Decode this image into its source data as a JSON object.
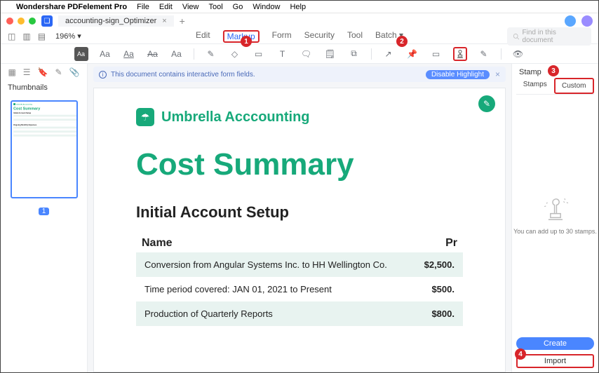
{
  "macmenu": {
    "app": "Wondershare PDFelement Pro",
    "items": [
      "File",
      "Edit",
      "View",
      "Tool",
      "Go",
      "Window",
      "Help"
    ]
  },
  "titlebar": {
    "tab_name": "accounting-sign_Optimizer",
    "close": "×",
    "plus": "+"
  },
  "secondbar": {
    "zoom": "196%  ▾",
    "modes": {
      "edit": "Edit",
      "markup": "Markup",
      "form": "Form",
      "security": "Security",
      "tool": "Tool",
      "batch": "Batch ▾"
    },
    "search_placeholder": "Find in this document"
  },
  "markuptools": {
    "text_bg": "Aa",
    "t1": "Aa",
    "t2": "Aa",
    "t3": "Aa",
    "t4": "Aa",
    "pencil": "✎",
    "eraser": "◇",
    "highlighter": "▭",
    "textbox": "T",
    "callout": "🗨",
    "note": "🗒",
    "link": "⧉",
    "arrow": "↗",
    "pin": "📌",
    "area": "▭",
    "stamp": "⌷",
    "sign": "✎",
    "eye": "👁"
  },
  "formbanner": {
    "text": "This document contains interactive form fields.",
    "disable": "Disable Highlight",
    "close": "×",
    "info": "i"
  },
  "left": {
    "thumbnails_label": "Thumbnails",
    "page_num": "1"
  },
  "doc": {
    "brand": "Umbrella Acccounting",
    "title": "Cost Summary",
    "section1": "Initial Account Setup",
    "section2": "Ongoing Monthly Expenses",
    "col_name": "Name",
    "col_price": "Pr",
    "rows": [
      {
        "name": "Conversion from Angular Systems Inc. to HH Wellington Co.",
        "price": "$2,500."
      },
      {
        "name": "Time period covered: JAN 01, 2021 to Present",
        "price": "$500."
      },
      {
        "name": "Production of Quarterly Reports",
        "price": "$800."
      }
    ]
  },
  "right": {
    "title": "Stamp",
    "tab_stamps": "Stamps",
    "tab_custom": "Custom",
    "empty_text": "You can add up to 30 stamps.",
    "create": "Create",
    "import": "Import"
  },
  "badges": {
    "b1": "1",
    "b2": "2",
    "b3": "3",
    "b4": "4"
  }
}
